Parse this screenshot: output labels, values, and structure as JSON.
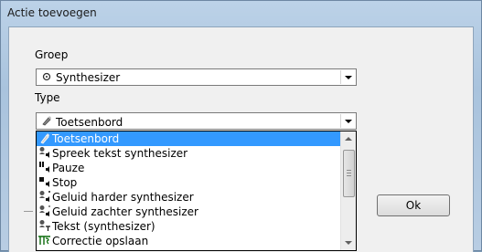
{
  "window": {
    "title": "Actie toevoegen"
  },
  "form": {
    "group_label": "Groep",
    "group_value": "Synthesizer",
    "group_icon": "speaker-small-icon",
    "type_label": "Type",
    "type_value": "Toetsenbord",
    "type_icon": "keyboard-pen-icon",
    "ok_label": "Ok"
  },
  "dropdown": {
    "items": [
      {
        "label": "Toetsenbord",
        "icon": "keyboard-pen-icon",
        "selected": true
      },
      {
        "label": "Spreek tekst synthesizer",
        "icon": "speaker-person-icon"
      },
      {
        "label": "Pauze",
        "icon": "pause-speaker-icon"
      },
      {
        "label": "Stop",
        "icon": "stop-speaker-icon"
      },
      {
        "label": "Geluid harder synthesizer",
        "icon": "volume-up-person-icon"
      },
      {
        "label": "Geluid zachter synthesizer",
        "icon": "volume-down-person-icon"
      },
      {
        "label": "Tekst (synthesizer)",
        "icon": "text-person-icon"
      },
      {
        "label": "Correctie opslaan",
        "icon": "tts-icon"
      }
    ],
    "scroll_position": 0.15
  },
  "colors": {
    "selection": "#3399ff"
  }
}
